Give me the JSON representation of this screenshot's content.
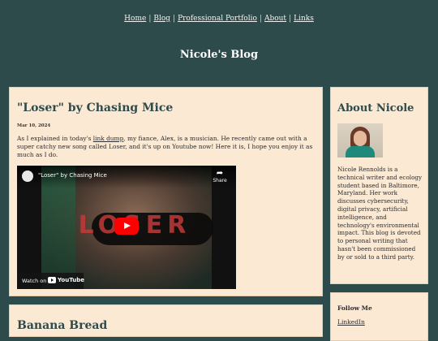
{
  "nav": {
    "items": [
      {
        "label": "Home"
      },
      {
        "label": "Blog"
      },
      {
        "label": "Professional Portfolio"
      },
      {
        "label": "About"
      },
      {
        "label": "Links"
      }
    ],
    "separator": "|"
  },
  "site": {
    "title": "Nicole's Blog"
  },
  "posts": [
    {
      "title": "\"Loser\" by Chasing Mice",
      "date": "Mar 10, 2024",
      "body_before": "As I explained in today's ",
      "link": "link dump",
      "body_after": ", my fiance, Alex, is a musician. He recently came out with a super catchy new song called Loser, and it's up on Youtube now! Here it is, I hope you enjoy it as much as I do.",
      "video": {
        "title": "\"Loser\" by Chasing Mice",
        "share_label": "Share",
        "watch_on": "Watch on",
        "youtube": "YouTube",
        "art_text": "LOSER"
      }
    },
    {
      "title": "Banana Bread"
    }
  ],
  "sidebar": {
    "about": {
      "title": "About Nicole",
      "text": "Nicole Rennolds is a technical writer and ecology student based in Baltimore, Maryland. Her work discusses cybersecurity, digital privacy, artificial intelligence, and technology's environmental impact. This blog is devoted to personal writing that hasn't been commissioned by or sold to a third party."
    },
    "follow": {
      "title": "Follow Me",
      "links": [
        {
          "label": "LinkedIn"
        }
      ]
    }
  },
  "colors": {
    "background": "#2d4b4b",
    "card": "#fbe9d4",
    "heading": "#2f4a4a",
    "youtube_red": "#ff0000"
  }
}
